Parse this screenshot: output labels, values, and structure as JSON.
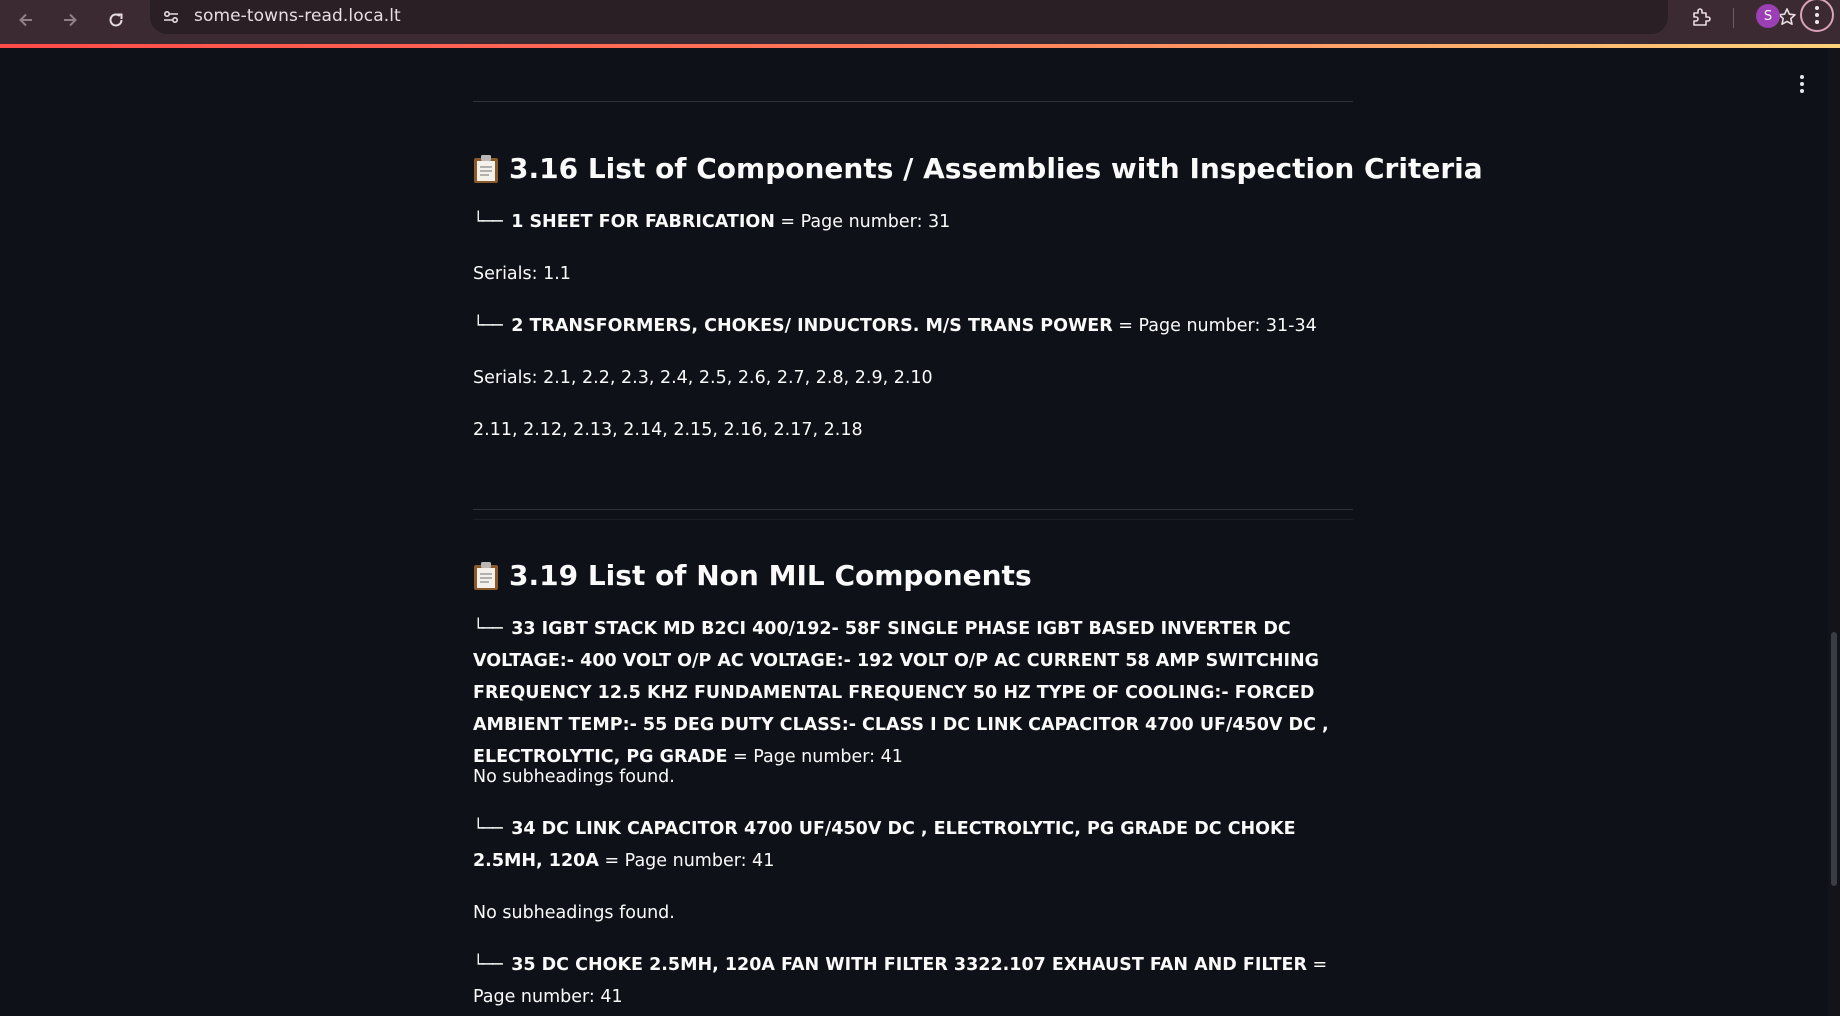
{
  "browser": {
    "url": "some-towns-read.loca.lt",
    "profile_initial": "S",
    "accent": "#9c3fb5"
  },
  "sections": [
    {
      "title": "3.16 List of Components / Assemblies with Inspection Criteria",
      "icon": "clipboard-icon",
      "items": [
        {
          "tree": "└──",
          "name": "1 SHEET FOR FABRICATION",
          "page": " = Page number: 31",
          "serials": "Serials: 1.1"
        },
        {
          "tree": "└──",
          "name": "2 TRANSFORMERS, CHOKES/ INDUCTORS. M/S TRANS POWER",
          "page": " = Page number: 31-34",
          "serials": "Serials: 2.1, 2.2, 2.3, 2.4, 2.5, 2.6, 2.7, 2.8, 2.9, 2.10",
          "serials_cont": "2.11, 2.12, 2.13, 2.14, 2.15, 2.16, 2.17, 2.18"
        }
      ]
    },
    {
      "title": "3.19 List of Non MIL Components",
      "icon": "clipboard-icon",
      "items": [
        {
          "tree": "└──",
          "name": "33 IGBT STACK MD B2CI 400/192- 58F SINGLE PHASE IGBT BASED INVERTER DC VOLTAGE:- 400 VOLT O/P AC VOLTAGE:- 192 VOLT O/P AC CURRENT 58 AMP SWITCHING FREQUENCY 12.5 KHZ FUNDAMENTAL FREQUENCY 50 HZ TYPE OF COOLING:- FORCED AMBIENT TEMP:- 55 DEG DUTY CLASS:- CLASS I DC LINK CAPACITOR 4700 UF/450V DC , ELECTROLYTIC, PG GRADE",
          "page": " = Page number: 41",
          "serials": "No subheadings found."
        },
        {
          "tree": "└──",
          "name": "34 DC LINK CAPACITOR 4700 UF/450V DC , ELECTROLYTIC, PG GRADE DC CHOKE 2.5MH, 120A",
          "page": " = Page number: 41",
          "serials": "No subheadings found."
        },
        {
          "tree": "└──",
          "name": "35 DC CHOKE 2.5MH, 120A FAN WITH FILTER 3322.107 EXHAUST FAN AND FILTER",
          "page": " = Page number: 41"
        }
      ]
    }
  ]
}
